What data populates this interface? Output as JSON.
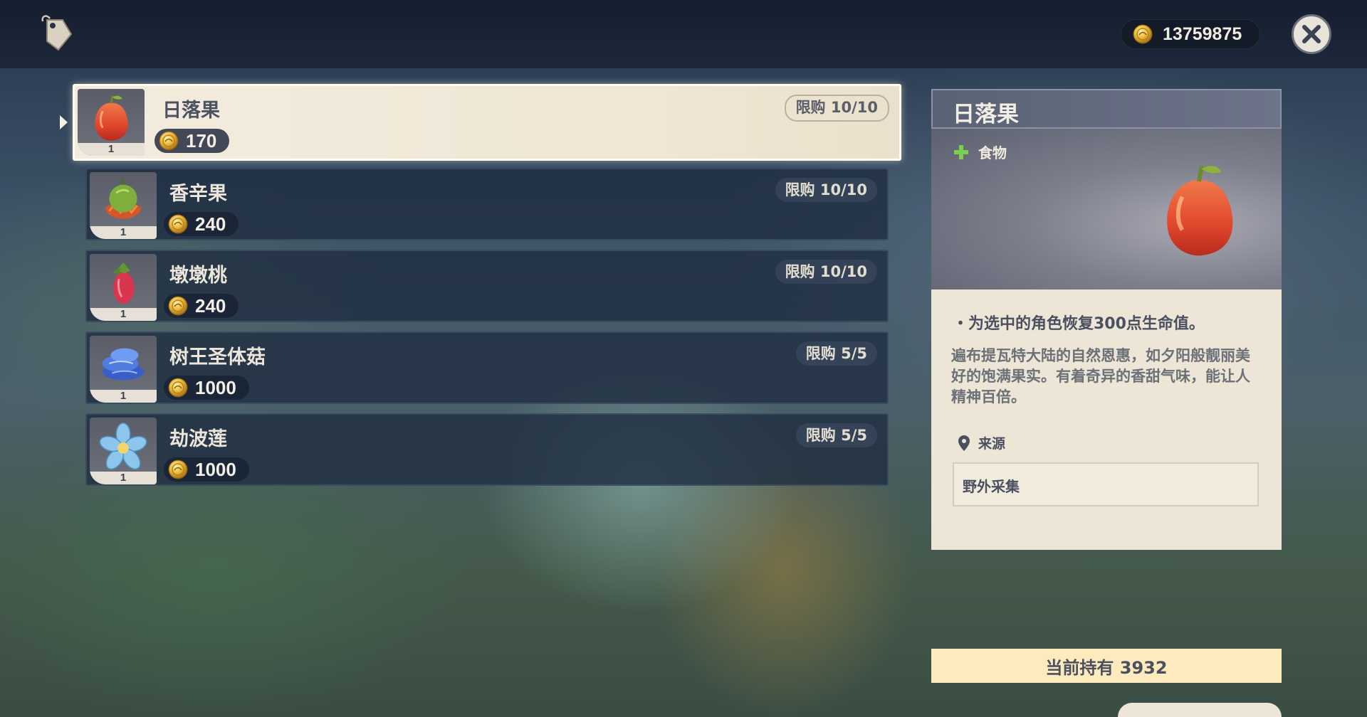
{
  "topbar": {
    "mora_amount": "13759875",
    "icons": {
      "shop": "tag-icon",
      "currency": "mora-coin-icon",
      "close": "close-icon"
    }
  },
  "items": [
    {
      "name": "日落果",
      "price": "170",
      "limit": "限购 10/10",
      "count": "1",
      "icon": "sunsettia-icon",
      "selected": true
    },
    {
      "name": "香辛果",
      "price": "240",
      "limit": "限购 10/10",
      "count": "1",
      "icon": "harra-fruit-icon",
      "selected": false
    },
    {
      "name": "墩墩桃",
      "price": "240",
      "limit": "限购 10/10",
      "count": "1",
      "icon": "zaytun-peach-icon",
      "selected": false
    },
    {
      "name": "树王圣体菇",
      "price": "1000",
      "limit": "限购 5/5",
      "count": "1",
      "icon": "rukkhashava-mushroom-icon",
      "selected": false
    },
    {
      "name": "劫波莲",
      "price": "1000",
      "limit": "限购 5/5",
      "count": "1",
      "icon": "padisarah-icon",
      "selected": false
    }
  ],
  "detail": {
    "title": "日落果",
    "type": "食物",
    "effect": "・为选中的角色恢复300点生命值。",
    "description": "遍布提瓦特大陆的自然恩惠，如夕阳般靓丽美好的饱满果实。有着奇异的香甜气味，能让人精神百倍。",
    "source_label": "来源",
    "source_value": "野外采集"
  },
  "owned": "当前持有 3932",
  "colors": {
    "selected_row_bg": "#f3ecde",
    "row_bg": "#202e42",
    "owned_bar_bg": "#fdebbd",
    "detail_body_bg": "#ede6d6",
    "text_dark": "#4b5060"
  }
}
